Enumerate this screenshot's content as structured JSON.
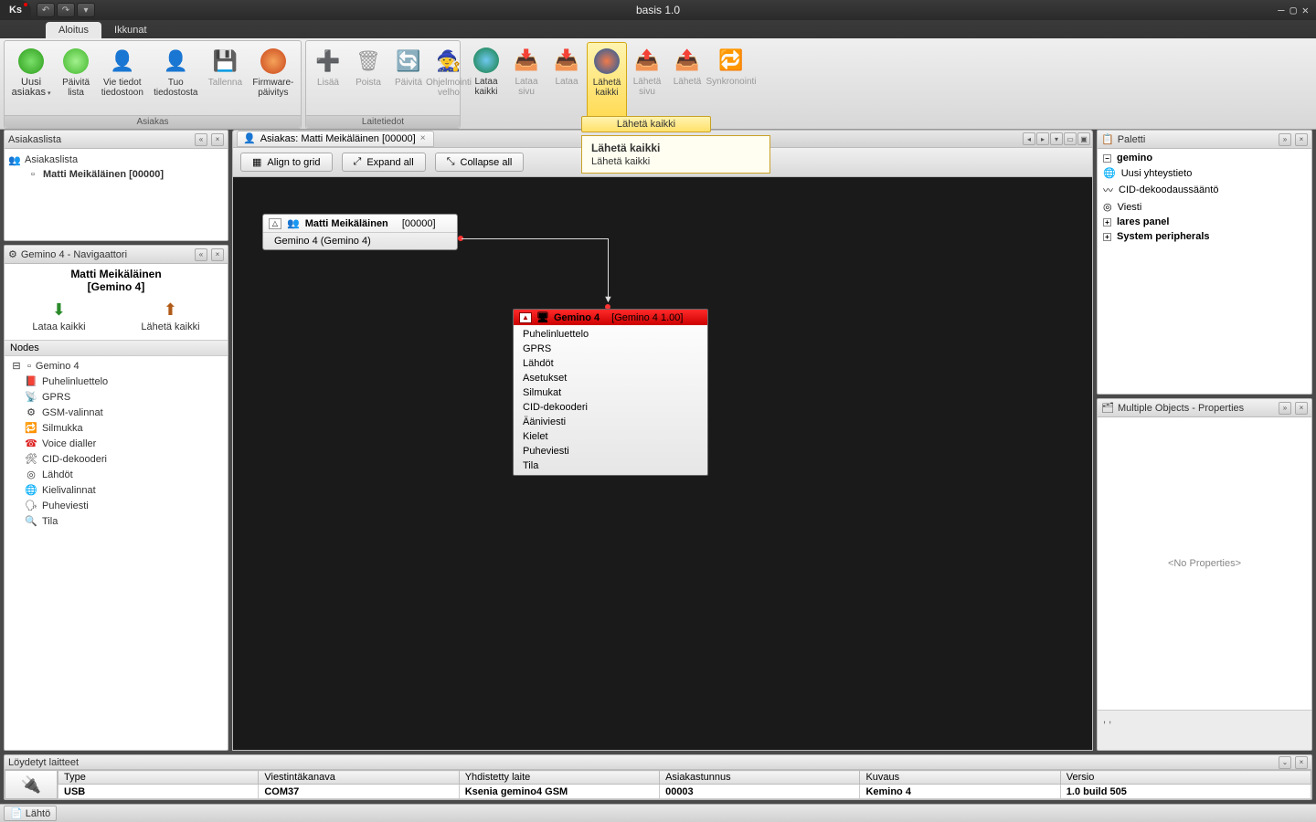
{
  "window": {
    "title": "basis 1.0"
  },
  "tabs": {
    "home": "Aloitus",
    "windows": "Ikkunat"
  },
  "ribbon": {
    "group1": {
      "title": "Asiakas",
      "new_customer": "Uusi\nasiakas",
      "refresh_list": "Päivitä\nlista",
      "export": "Vie tiedot\ntiedostoon",
      "import": "Tuo\ntiedostosta",
      "save": "Tallenna",
      "firmware": "Firmware-\npäivitys"
    },
    "group2": {
      "title": "Laitetiedot",
      "add": "Lisää",
      "remove": "Poista",
      "refresh": "Päivitä",
      "wizard": "Ohjelmointi\nvelho"
    },
    "group3": {
      "load_all": "Lataa\nkaikki",
      "load_page": "Lataa\nsivu",
      "load": "Lataa",
      "send_all": "Lähetä\nkaikki",
      "send_page": "Lähetä\nsivu",
      "send": "Lähetä",
      "sync": "Synkronointi"
    }
  },
  "tooltip": {
    "caption": "Lähetä kaikki",
    "title": "Lähetä kaikki",
    "body": "Lähetä kaikki"
  },
  "customer_panel": {
    "title": "Asiakaslista",
    "root": "Asiakaslista",
    "customer_name": "Matti Meikäläinen",
    "customer_code": "[00000]"
  },
  "navigator": {
    "title": "Gemino 4 - Navigaattori",
    "name": "Matti Meikäläinen",
    "sub": "[Gemino 4]",
    "load_all": "Lataa\nkaikki",
    "send_all": "Lähetä\nkaikki",
    "section": "Nodes",
    "root": "Gemino 4",
    "items": [
      "Puhelinluettelo",
      "GPRS",
      "GSM-valinnat",
      "Silmukka",
      "Voice dialler",
      "CID-dekooderi",
      "Lähdöt",
      "Kielivalinnat",
      "Puheviesti",
      "Tila"
    ]
  },
  "doc": {
    "tab_label": "Asiakas: Matti Meikäläinen [00000]",
    "align": "Align to grid",
    "expand": "Expand all",
    "collapse": "Collapse all"
  },
  "canvas": {
    "cust_name": "Matti Meikäläinen",
    "cust_code": "[00000]",
    "cust_sub": "Gemino 4 (Gemino 4)",
    "dev_name": "Gemino 4",
    "dev_ver": "[Gemino 4 1.00]",
    "dev_items": [
      "Puhelinluettelo",
      "GPRS",
      "Lähdöt",
      "Asetukset",
      "Silmukat",
      "CID-dekooderi",
      "Ääniviesti",
      "Kielet",
      "Puheviesti",
      "Tila"
    ]
  },
  "palette": {
    "title": "Paletti",
    "group": "gemino",
    "items": [
      "Uusi yhteystieto",
      "CID-dekoodaussääntö",
      "Viesti"
    ],
    "extra": [
      "lares panel",
      "System peripherals"
    ]
  },
  "properties": {
    "title": "Multiple Objects - Properties",
    "empty": "<No Properties>",
    "footer": ", ,"
  },
  "devices": {
    "title": "Löydetyt laitteet",
    "cols": [
      "Type",
      "Viestintäkanava",
      "Yhdistetty laite",
      "Asiakastunnus",
      "Kuvaus",
      "Versio"
    ],
    "row": [
      "USB",
      "COM37",
      "Ksenia gemino4 GSM",
      "00003",
      "Kemino 4",
      "1.0 build 505"
    ]
  },
  "status": {
    "out": "Lähtö"
  }
}
